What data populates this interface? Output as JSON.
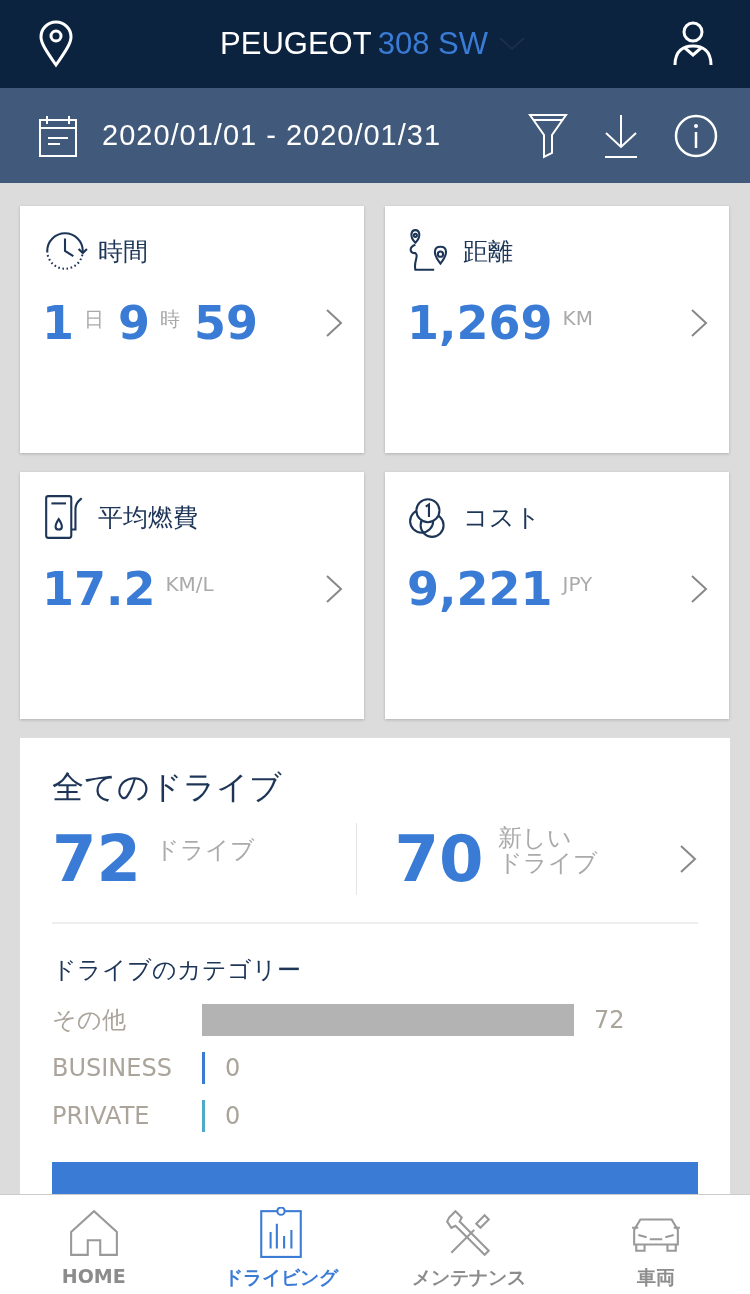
{
  "header": {
    "brand": "PEUGEOT",
    "model": "308 SW"
  },
  "date_bar": {
    "range": "2020/01/01 - 2020/01/31"
  },
  "cards": [
    {
      "kind": "time",
      "title": "時間",
      "values": [
        {
          "number": "1",
          "unit": "日"
        },
        {
          "number": "9",
          "unit": "時"
        },
        {
          "number": "59"
        }
      ]
    },
    {
      "kind": "distance",
      "title": "距離",
      "values": [
        {
          "number": "1,269",
          "unit": "KM"
        }
      ]
    },
    {
      "kind": "fuel",
      "title": "平均燃費",
      "values": [
        {
          "number": "17.2",
          "unit": "KM/L"
        }
      ]
    },
    {
      "kind": "cost",
      "title": "コスト",
      "values": [
        {
          "number": "9,221",
          "unit": "JPY"
        }
      ]
    }
  ],
  "drives": {
    "title": "全てのドライブ",
    "total": {
      "number": "72",
      "label": "ドライブ"
    },
    "new": {
      "number": "70",
      "label_lines": [
        "新しい",
        "ドライブ"
      ]
    },
    "categories_title": "ドライブのカテゴリー",
    "categories": [
      {
        "name": "その他",
        "count": "72",
        "color": "#b3b3b3"
      },
      {
        "name": "BUSINESS",
        "count": "0",
        "color": "#3a7bd5"
      },
      {
        "name": "PRIVATE",
        "count": "0",
        "color": "#4eaac8"
      }
    ]
  },
  "tabs": [
    {
      "kind": "home",
      "label": "HOME",
      "selected": false
    },
    {
      "kind": "driving",
      "label": "ドライビング",
      "selected": true
    },
    {
      "kind": "maintenance",
      "label": "メンテナンス",
      "selected": false
    },
    {
      "kind": "vehicle",
      "label": "車両",
      "selected": false
    }
  ]
}
